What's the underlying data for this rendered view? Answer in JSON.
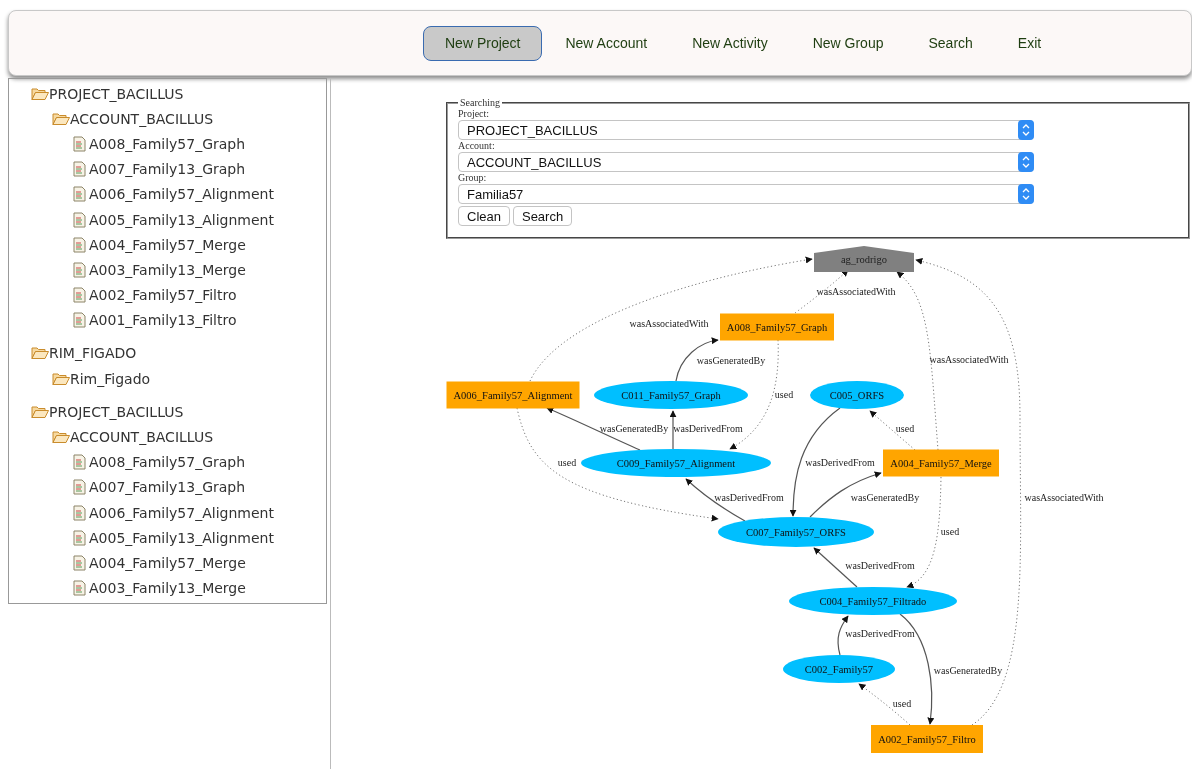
{
  "nav": [
    {
      "label": "New Project",
      "selected": true
    },
    {
      "label": "New Account",
      "selected": false
    },
    {
      "label": "New Activity",
      "selected": false
    },
    {
      "label": "New Group",
      "selected": false
    },
    {
      "label": "Search",
      "selected": false
    },
    {
      "label": "Exit",
      "selected": false
    }
  ],
  "tree": [
    {
      "label": "PROJECT_BACILLUS",
      "kind": "folder",
      "children": [
        {
          "label": "ACCOUNT_BACILLUS",
          "kind": "folder",
          "children": [
            {
              "label": "A008_Family57_Graph",
              "kind": "file"
            },
            {
              "label": "A007_Family13_Graph",
              "kind": "file"
            },
            {
              "label": "A006_Family57_Alignment",
              "kind": "file"
            },
            {
              "label": "A005_Family13_Alignment",
              "kind": "file"
            },
            {
              "label": "A004_Family57_Merge",
              "kind": "file"
            },
            {
              "label": "A003_Family13_Merge",
              "kind": "file"
            },
            {
              "label": "A002_Family57_Filtro",
              "kind": "file"
            },
            {
              "label": "A001_Family13_Filtro",
              "kind": "file"
            }
          ]
        }
      ]
    },
    {
      "label": "RIM_FIGADO",
      "kind": "folder",
      "children": [
        {
          "label": "Rim_Figado",
          "kind": "folder"
        }
      ]
    },
    {
      "label": "PROJECT_BACILLUS",
      "kind": "folder",
      "children": [
        {
          "label": "ACCOUNT_BACILLUS",
          "kind": "folder",
          "children": [
            {
              "label": "A008_Family57_Graph",
              "kind": "file"
            },
            {
              "label": "A007_Family13_Graph",
              "kind": "file"
            },
            {
              "label": "A006_Family57_Alignment",
              "kind": "file"
            },
            {
              "label": "A005_Family13_Alignment",
              "kind": "file"
            },
            {
              "label": "A004_Family57_Merge",
              "kind": "file"
            },
            {
              "label": "A003_Family13_Merge",
              "kind": "file"
            }
          ]
        }
      ]
    }
  ],
  "search": {
    "legend": "Searching",
    "fields": [
      {
        "label": "Project:",
        "value": "PROJECT_BACILLUS"
      },
      {
        "label": "Account:",
        "value": "ACCOUNT_BACILLUS"
      },
      {
        "label": "Group:",
        "value": "Familia57"
      }
    ],
    "buttons": [
      "Clean",
      "Search"
    ]
  },
  "graph": {
    "nodes": [
      {
        "label": "ag_rodrigo",
        "kind": "agent"
      },
      {
        "label": "A008_Family57_Graph",
        "kind": "activity"
      },
      {
        "label": "A006_Family57_Alignment",
        "kind": "activity"
      },
      {
        "label": "C011_Family57_Graph",
        "kind": "entity"
      },
      {
        "label": "C005_ORFS",
        "kind": "entity"
      },
      {
        "label": "C009_Family57_Alignment",
        "kind": "entity"
      },
      {
        "label": "A004_Family57_Merge",
        "kind": "activity"
      },
      {
        "label": "C007_Family57_ORFS",
        "kind": "entity"
      },
      {
        "label": "C004_Family57_Filtrado",
        "kind": "entity"
      },
      {
        "label": "C002_Family57",
        "kind": "entity"
      },
      {
        "label": "A002_Family57_Filtro",
        "kind": "activity"
      }
    ],
    "edges": [
      {
        "label": "wasAssociatedWith",
        "kind": "dotted"
      },
      {
        "label": "wasAssociatedWith",
        "kind": "dotted"
      },
      {
        "label": "wasAssociatedWith",
        "kind": "dotted"
      },
      {
        "label": "wasAssociatedWith",
        "kind": "dotted"
      },
      {
        "label": "wasGeneratedBy",
        "kind": "solid"
      },
      {
        "label": "used",
        "kind": "dotted"
      },
      {
        "label": "wasGeneratedBy",
        "kind": "solid"
      },
      {
        "label": "wasDerivedFrom",
        "kind": "solid"
      },
      {
        "label": "used",
        "kind": "dotted"
      },
      {
        "label": "used",
        "kind": "dotted"
      },
      {
        "label": "wasDerivedFrom",
        "kind": "solid"
      },
      {
        "label": "wasDerivedFrom",
        "kind": "solid"
      },
      {
        "label": "wasGeneratedBy",
        "kind": "solid"
      },
      {
        "label": "wasDerivedFrom",
        "kind": "solid"
      },
      {
        "label": "used",
        "kind": "dotted"
      },
      {
        "label": "wasDerivedFrom",
        "kind": "solid"
      },
      {
        "label": "wasGeneratedBy",
        "kind": "solid"
      },
      {
        "label": "used",
        "kind": "dotted"
      }
    ]
  }
}
